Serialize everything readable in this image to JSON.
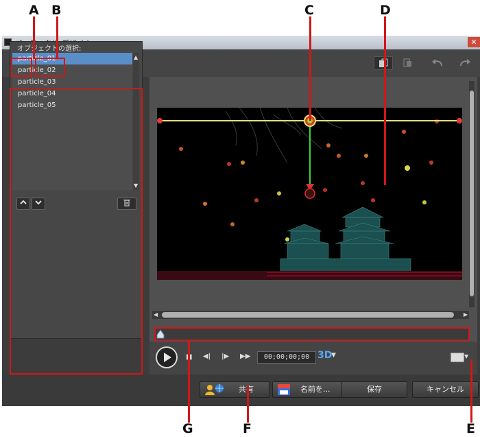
{
  "window": {
    "title": "パーティクル デザイナー"
  },
  "toolbar": {
    "add_particle_icon": "sparkle-add",
    "add_image_icon": "image-add",
    "dropdown_arrow": "▾",
    "right_icons": [
      "copy-icon",
      "paste-icon",
      "undo-icon",
      "redo-icon"
    ]
  },
  "objects": {
    "header": "オブジェクトの選択:",
    "items": [
      "particle_01",
      "particle_02",
      "particle_03",
      "particle_04",
      "particle_05"
    ],
    "selected_index": 0
  },
  "player": {
    "timecode": "00;00;00;00",
    "mode_3d": "3D"
  },
  "bottom": {
    "share_label": "共有",
    "save_as_label": "名前を...",
    "save_label": "保存",
    "cancel_label": "キャンセル"
  },
  "callouts": {
    "a": "A",
    "b": "B",
    "c": "C",
    "d": "D",
    "e": "E",
    "f": "F",
    "g": "G"
  },
  "colors": {
    "highlight_red": "#d01818",
    "selection_blue": "#5a8ec8",
    "path_yellow": "#e6e07a",
    "path_green": "#3fd23a"
  }
}
